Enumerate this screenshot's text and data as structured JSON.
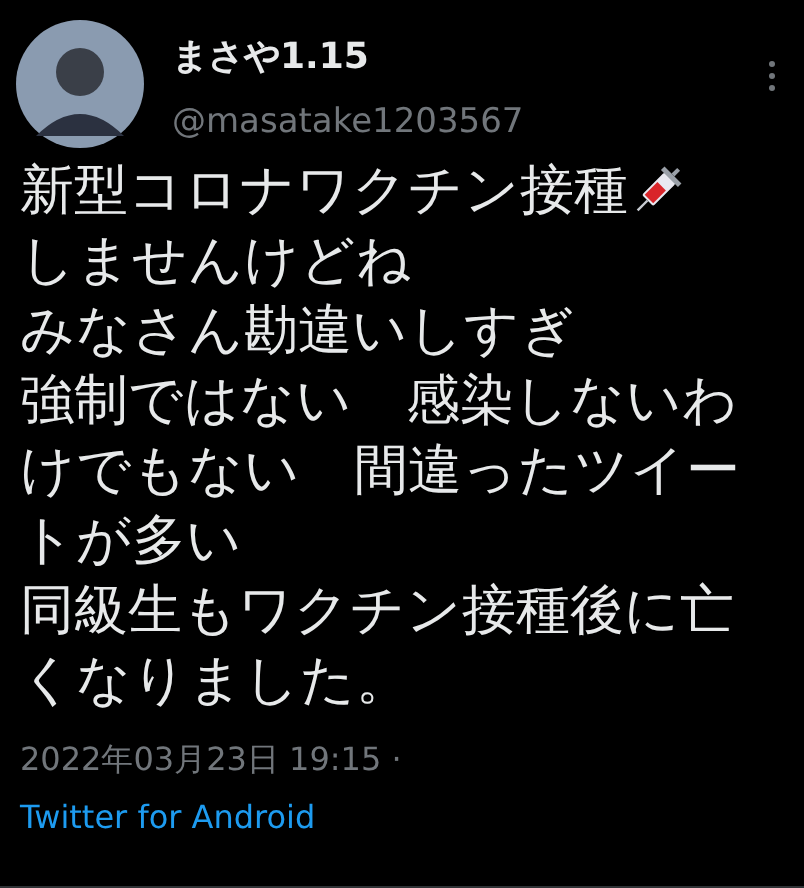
{
  "author": {
    "name": "まさや1.15",
    "handle": "@masatake1203567"
  },
  "tweet": {
    "headline": "新型コロナワクチン接種",
    "lines": [
      "しませんけどね",
      "みなさん勘違いしすぎ",
      "強制ではない　感染しないわけでもない　間違ったツイートが多い",
      "同級生もワクチン接種後に亡くなりました。"
    ]
  },
  "timestamp": "2022年03月23日 19:15 ·",
  "source": "Twitter for Android"
}
